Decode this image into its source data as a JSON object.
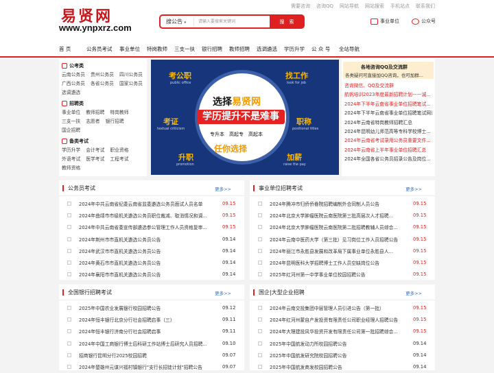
{
  "top_links": [
    "需要咨询",
    "咨询QQ",
    "网站导航",
    "网站搜索",
    "手机站点",
    "联系我们"
  ],
  "logo": {
    "text": "易贤网",
    "url": "www.ynpxrz.com"
  },
  "search": {
    "selected": "搜公告",
    "placeholder": "请输入要搜索关键词",
    "button": "搜　索"
  },
  "header_icons": {
    "unit": "事业单位",
    "gzh": "公众号"
  },
  "nav": [
    "首 页",
    "公务员考试",
    "事业单位",
    "特岗教师",
    "三支一扶",
    "银行招聘",
    "教师招聘",
    "选调遴选",
    "学历升学",
    "公 众 号",
    "全站导航"
  ],
  "categories": [
    {
      "title": "公考类",
      "links": [
        "云南公务员",
        "贵州公务员",
        "四川公务员",
        "广西公务员",
        "各省公务员",
        "国家公务员",
        "选调遴选"
      ]
    },
    {
      "title": "招聘类",
      "links": [
        "事业单位",
        "教师招聘",
        "特岗教师",
        "三支一扶",
        "志愿者",
        "银行招聘",
        "国企招聘"
      ]
    },
    {
      "title": "备类考试",
      "links": [
        "学历升学",
        "会计考试",
        "职业资格",
        "外语考试",
        "医学考试",
        "工程考试",
        "教师资格"
      ]
    }
  ],
  "banner": {
    "corners": [
      {
        "cn": "考公职",
        "en": "public office"
      },
      {
        "cn": "找工作",
        "en": "look for job"
      },
      {
        "cn": "考证",
        "en": "textual criticism"
      },
      {
        "cn": "职称",
        "en": "positional titles"
      },
      {
        "cn": "升职",
        "en": "promotion"
      },
      {
        "cn": "加薪",
        "en": "raise the pay"
      }
    ],
    "line1_prefix": "选择",
    "line1_brand": "易贤网",
    "line2": "学历提升不是难事",
    "line3": "专升本　高起专　高起本",
    "line4": "任你选择"
  },
  "qq_box": {
    "title": "各地咨询QQ及交流群",
    "subtitle": "各类疑问可直接加QQ咨询，也可加群...",
    "items": [
      {
        "text": "咨询微信、QQ及交流群",
        "color": "#e02020"
      },
      {
        "text": "航帆培训2023年度最新招聘计划——诚...",
        "color": "#e02020"
      },
      {
        "text": "2024年下半年云南省事业单位招聘笔试...",
        "color": "#e02020"
      },
      {
        "text": "2024年下半年云南省事业单位招聘笔试网课",
        "color": "#333333"
      },
      {
        "text": "2024年云南省特岗教师招聘汇总",
        "color": "#333333"
      },
      {
        "text": "2024年昆明幼儿师范高等专科学校博士...",
        "color": "#333333"
      },
      {
        "text": "2024年云南省考试录用公务员重要文件...",
        "color": "#e02020"
      },
      {
        "text": "2024年云南省上半年事业单位招聘汇总",
        "color": "#e02020"
      },
      {
        "text": "2024年全国各省公务员招录公告及岗位...",
        "color": "#333333"
      }
    ]
  },
  "panels": [
    {
      "title": "公务员考试",
      "more": "更多>>",
      "items": [
        {
          "text": "2024年中共云南省纪委云南省监委遴选公务员面试人员名单",
          "date": "09.15",
          "red": true
        },
        {
          "text": "2024年曲靖市市级机关遴选公务员职位裁减、取消情况和调...",
          "date": "09.15",
          "red": true
        },
        {
          "text": "2024年中共云南省委宣传部遴选参公管理工作人员资格复审...",
          "date": "09.15",
          "red": true
        },
        {
          "text": "2024年荆州市市直机关遴选公务员公告",
          "date": "09.14",
          "red": false
        },
        {
          "text": "2024年武汉市市直机关遴选公务员公告",
          "date": "09.14",
          "red": false
        },
        {
          "text": "2024年黄石市市直机关遴选公务员公告",
          "date": "09.14",
          "red": false
        },
        {
          "text": "2024年襄阳市市直机关遴选公务员公告",
          "date": "09.14",
          "red": false
        }
      ]
    },
    {
      "title": "事业单位招聘考试",
      "more": "更多>>",
      "items": [
        {
          "text": "2024年腾冲市归侨侨眷院招聘编制外合同制人员公告",
          "date": "09.15",
          "red": true
        },
        {
          "text": "2024年北京大学肿瘤医院云南医院第三批高层次人才招聘...",
          "date": "09.15",
          "red": true
        },
        {
          "text": "2024年北京大学肿瘤医院云南医院第二批招聘教辅人员综合...",
          "date": "09.15",
          "red": true
        },
        {
          "text": "2024年云南中医药大学（第三批）见习岗位工作人员招聘公告",
          "date": "09.15",
          "red": true
        },
        {
          "text": "2024年丽江市永胜县发展和改革局下属事业单位永胜县人...",
          "date": "09.15",
          "red": true
        },
        {
          "text": "2024年昆明医科大学招聘博士工作人员空缺岗位公告",
          "date": "09.15",
          "red": true
        },
        {
          "text": "2025年红河州第一中学事业单位校园招聘公告",
          "date": "09.15",
          "red": true
        }
      ]
    },
    {
      "title": "全国银行招聘考试",
      "more": "更多>>",
      "items": [
        {
          "text": "2025年中国农业发展银行校园招聘公告",
          "date": "09.12",
          "red": false
        },
        {
          "text": "2024年恒丰银行北京分行社会招聘启事（三）",
          "date": "09.11",
          "red": false
        },
        {
          "text": "2024年恒丰银行济南分行社会招聘启事",
          "date": "09.11",
          "red": false
        },
        {
          "text": "2024年中国工商银行博士后科研工作站博士后研究人员招聘...",
          "date": "09.10",
          "red": false
        },
        {
          "text": "招商银行昆明分行2025校园招聘",
          "date": "09.07",
          "red": false
        },
        {
          "text": "2024年楚雄州元谋兴福村镇银行\"支行长招徒计划\"招聘公告",
          "date": "09.07",
          "red": false
        }
      ]
    },
    {
      "title": "国企|大型企业招聘",
      "more": "更多>>",
      "items": [
        {
          "text": "2024年云南交投集团中层管理人员引进公告（第一批）",
          "date": "09.15",
          "red": true
        },
        {
          "text": "2024年红河州蒙自产发投资有限责任公司职业经理人招聘公告",
          "date": "09.15",
          "red": true
        },
        {
          "text": "2024年大理建投风华投资开发有限责任公司第一批招聘综合...",
          "date": "09.15",
          "red": true
        },
        {
          "text": "2025年中国航发动力所校园招聘公告",
          "date": "09.14",
          "red": false
        },
        {
          "text": "2025年中国航发研究院校园招聘公告",
          "date": "09.14",
          "red": false
        },
        {
          "text": "2025年中国航发商发校园招聘公告",
          "date": "09.14",
          "red": false
        }
      ]
    }
  ]
}
